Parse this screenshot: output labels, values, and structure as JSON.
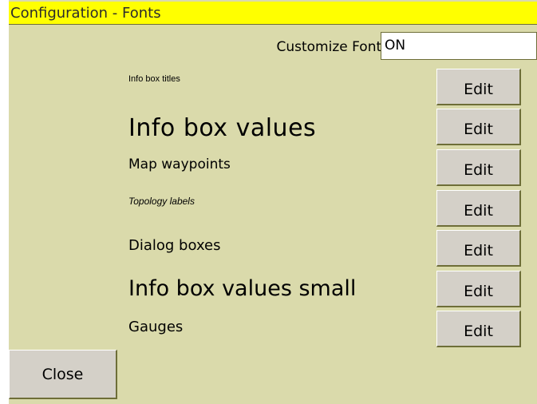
{
  "window": {
    "title": "Configuration - Fonts"
  },
  "customize": {
    "label": "Customize Fonts",
    "value": "ON"
  },
  "fonts": [
    {
      "label": "Info box titles",
      "button": "Edit"
    },
    {
      "label": "Info box values",
      "button": "Edit"
    },
    {
      "label": "Map waypoints",
      "button": "Edit"
    },
    {
      "label": "Topology labels",
      "button": "Edit"
    },
    {
      "label": "Dialog boxes",
      "button": "Edit"
    },
    {
      "label": "Info box values small",
      "button": "Edit"
    },
    {
      "label": "Gauges",
      "button": "Edit"
    }
  ],
  "actions": {
    "close_label": "Close"
  }
}
